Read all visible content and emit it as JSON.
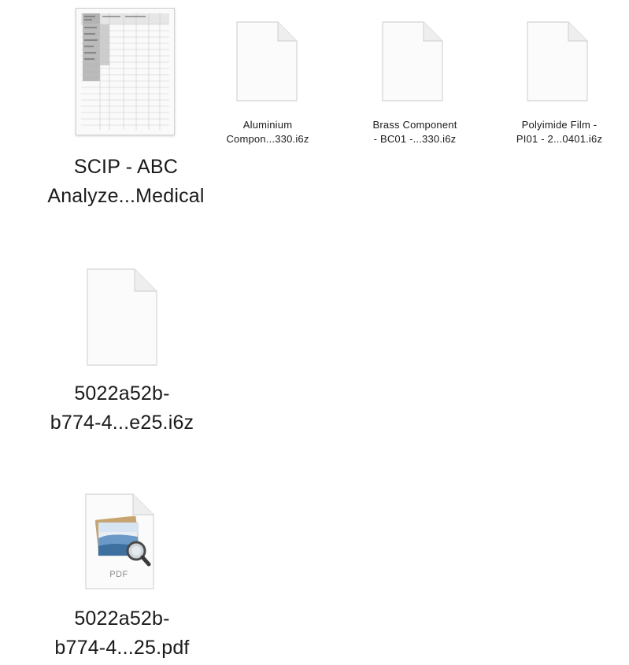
{
  "files": [
    {
      "name_line1": "SCIP - ABC",
      "name_line2": "Analyze...Medical",
      "icon": "spreadsheet-thumbnail-icon"
    },
    {
      "name_line1": "Aluminium",
      "name_line2": "Compon...330.i6z",
      "icon": "blank-document-icon"
    },
    {
      "name_line1": "Brass Component",
      "name_line2": "- BC01 -...330.i6z",
      "icon": "blank-document-icon"
    },
    {
      "name_line1": "Polyimide Film -",
      "name_line2": "PI01 - 2...0401.i6z",
      "icon": "blank-document-icon"
    },
    {
      "name_line1": "5022a52b-",
      "name_line2": "b774-4...e25.i6z",
      "icon": "blank-document-icon"
    },
    {
      "name_line1": "5022a52b-",
      "name_line2": "b774-4...25.pdf",
      "icon": "pdf-preview-icon",
      "badge": "PDF"
    }
  ],
  "colors": {
    "label_text": "#1a1a1a",
    "page_fill": "#fbfbfb",
    "page_stroke": "#d4d4d4",
    "fold_fill": "#eeeeee"
  }
}
